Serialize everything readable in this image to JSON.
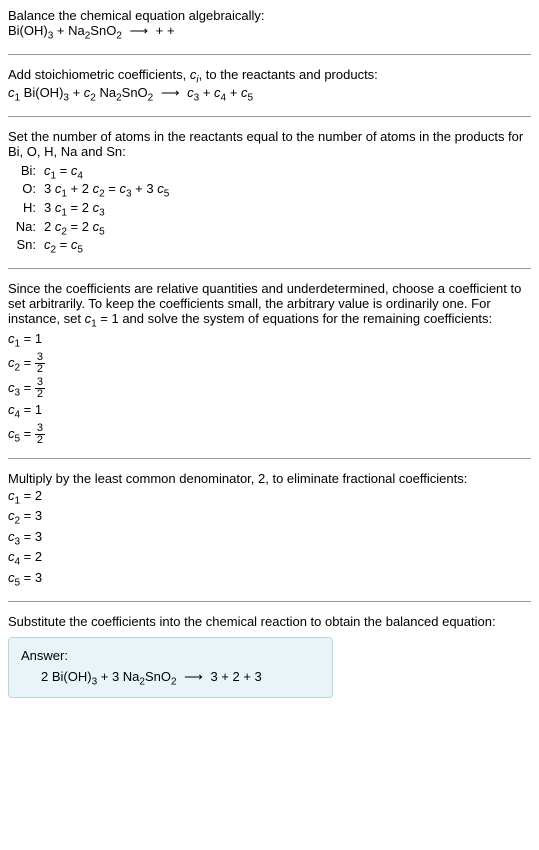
{
  "intro": {
    "line1": "Balance the chemical equation algebraically:",
    "reactant1": "Bi(OH)",
    "reactant1_sub": "3",
    "plus": " + ",
    "reactant2": "Na",
    "reactant2_sub": "2",
    "reactant2_part2": "SnO",
    "reactant2_sub2": "2",
    "arrow": "⟶",
    "products": "  +  + "
  },
  "stoich": {
    "text": "Add stoichiometric coefficients, ",
    "ci": "c",
    "ci_sub": "i",
    "text2": ", to the reactants and products:",
    "c1": "c",
    "s1": "1",
    "r1": " Bi(OH)",
    "r1s": "3",
    "c2": "c",
    "s2": "2",
    "r2a": " Na",
    "r2as": "2",
    "r2b": "SnO",
    "r2bs": "2",
    "c3": "c",
    "s3": "3",
    "c4": "c",
    "s4": "4",
    "c5": "c",
    "s5": "5"
  },
  "atoms": {
    "text": "Set the number of atoms in the reactants equal to the number of atoms in the products for Bi, O, H, Na and Sn:",
    "rows": [
      {
        "label": "Bi:",
        "eq_c1": "c",
        "eq_s1": "1",
        "eq_mid": " = ",
        "eq_c2": "c",
        "eq_s2": "4",
        "full": ""
      },
      {
        "label": "O:",
        "pre": "3 ",
        "c1": "c",
        "s1": "1",
        "mid1": " + 2 ",
        "c2": "c",
        "s2": "2",
        "mid2": " = ",
        "c3": "c",
        "s3": "3",
        "mid3": " + 3 ",
        "c4": "c",
        "s4": "5"
      },
      {
        "label": "H:",
        "pre": "3 ",
        "c1": "c",
        "s1": "1",
        "mid1": " = 2 ",
        "c2": "c",
        "s2": "3"
      },
      {
        "label": "Na:",
        "pre": "2 ",
        "c1": "c",
        "s1": "2",
        "mid1": " = 2 ",
        "c2": "c",
        "s2": "5"
      },
      {
        "label": "Sn:",
        "c1": "c",
        "s1": "2",
        "mid1": " = ",
        "c2": "c",
        "s2": "5"
      }
    ]
  },
  "solve": {
    "text": "Since the coefficients are relative quantities and underdetermined, choose a coefficient to set arbitrarily. To keep the coefficients small, the arbitrary value is ordinarily one. For instance, set ",
    "c1": "c",
    "s1": "1",
    "text2": " = 1 and solve the system of equations for the remaining coefficients:",
    "lines": [
      {
        "c": "c",
        "s": "1",
        "eq": " = 1",
        "frac": false
      },
      {
        "c": "c",
        "s": "2",
        "eq": " = ",
        "frac": true,
        "num": "3",
        "den": "2"
      },
      {
        "c": "c",
        "s": "3",
        "eq": " = ",
        "frac": true,
        "num": "3",
        "den": "2"
      },
      {
        "c": "c",
        "s": "4",
        "eq": " = 1",
        "frac": false
      },
      {
        "c": "c",
        "s": "5",
        "eq": " = ",
        "frac": true,
        "num": "3",
        "den": "2"
      }
    ]
  },
  "mult": {
    "text": "Multiply by the least common denominator, 2, to eliminate fractional coefficients:",
    "lines": [
      {
        "c": "c",
        "s": "1",
        "v": " = 2"
      },
      {
        "c": "c",
        "s": "2",
        "v": " = 3"
      },
      {
        "c": "c",
        "s": "3",
        "v": " = 3"
      },
      {
        "c": "c",
        "s": "4",
        "v": " = 2"
      },
      {
        "c": "c",
        "s": "5",
        "v": " = 3"
      }
    ]
  },
  "final": {
    "text": "Substitute the coefficients into the chemical reaction to obtain the balanced equation:",
    "answer_label": "Answer:",
    "eq_p1": "2 Bi(OH)",
    "eq_s1": "3",
    "eq_p2": " + 3 Na",
    "eq_s2": "2",
    "eq_p3": "SnO",
    "eq_s3": "2",
    "arrow": "⟶",
    "eq_p4": " 3  + 2  + 3"
  }
}
